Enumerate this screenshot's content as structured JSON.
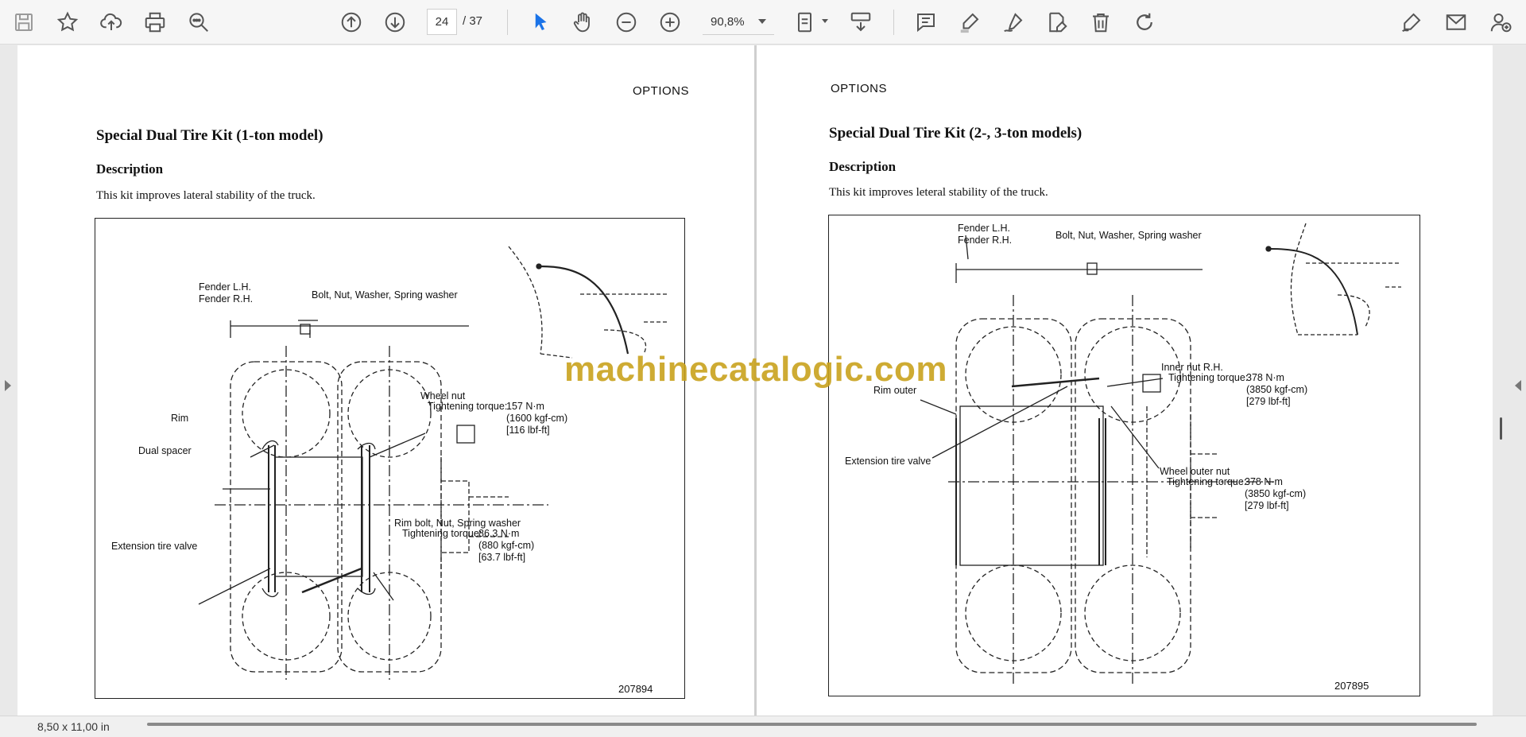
{
  "toolbar": {
    "icons": [
      "save-icon",
      "bookmark-star-icon",
      "upload-cloud-icon",
      "print-icon",
      "zoom-search-icon",
      "previous-page-icon",
      "next-page-icon",
      "select-cursor-icon",
      "hand-pan-icon",
      "zoom-out-icon",
      "zoom-in-icon",
      "fit-page-icon",
      "scroll-mode-icon",
      "comment-icon",
      "highlight-icon",
      "draw-icon",
      "edit-text-icon",
      "delete-icon",
      "rotate-icon",
      "sign-icon",
      "email-icon",
      "account-icon"
    ],
    "current_page": "24",
    "page_total": "/  37",
    "zoom": "90,8%"
  },
  "left_page": {
    "header": "OPTIONS",
    "title": "Special Dual Tire Kit (1-ton model)",
    "subtitle": "Description",
    "body": "This kit improves lateral stability of the truck.",
    "figure_code": "207894",
    "labels": {
      "fender": "Fender L.H.\nFender R.H.",
      "bolt": "Bolt, Nut, Washer, Spring washer",
      "wheel_nut": "Wheel nut",
      "wheel_torque": "Tightening torque:",
      "wheel_torque_vals": "157 N·m\n(1600 kgf-cm)\n[116 lbf-ft]",
      "rim": "Rim",
      "dual_spacer": "Dual spacer",
      "rim_bolt": "Rim bolt, Nut, Spring washer",
      "rim_torque": "Tightening torque:",
      "rim_torque_vals": "86.3 N·m\n(880 kgf-cm)\n[63.7 lbf-ft]",
      "valve": "Extension tire valve"
    }
  },
  "right_page": {
    "header": "OPTIONS",
    "title": "Special Dual Tire Kit (2-, 3-ton models)",
    "subtitle": "Description",
    "body": "This kit improves leteral stability of the truck.",
    "figure_code": "207895",
    "labels": {
      "fender": "Fender L.H.\nFender R.H.",
      "bolt": "Bolt, Nut, Washer, Spring washer",
      "inner_nut": "Inner nut R.H.",
      "inner_torque": "Tightening torque:",
      "inner_torque_vals": "378 N·m\n(3850 kgf-cm)\n[279 lbf-ft]",
      "rim_outer": "Rim outer",
      "valve": "Extension tire valve",
      "outer_nut": "Wheel outer nut",
      "outer_torque": "Tightening torque:",
      "outer_torque_vals": "378 N·m\n(3850 kgf-cm)\n[279 lbf-ft]"
    }
  },
  "watermark": "machinecatalogic.com",
  "status": {
    "page_size": "8,50 x 11,00 in"
  },
  "colors": {
    "watermark": "#c9a21e",
    "select_tool": "#1a73e8",
    "icon": "#555555"
  }
}
